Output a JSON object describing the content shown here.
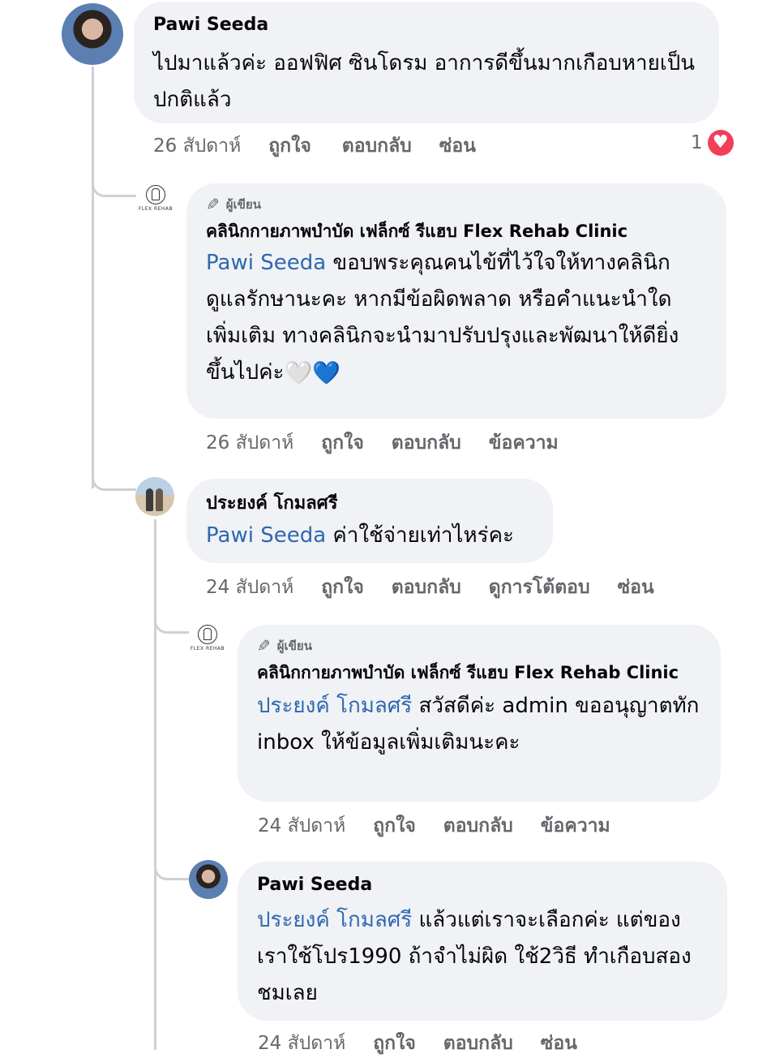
{
  "comments": [
    {
      "author": "Pawi Seeda",
      "text": "ไปมาแล้วค่ะ ออฟฟิศ ซินโดรม อาการดีขึ้นมากเกือบหายเป็นปกติแล้ว",
      "time": "26 สัปดาห์",
      "actions": [
        "ถูกใจ",
        "ตอบกลับ",
        "ซ่อน"
      ],
      "reaction_count": "1",
      "reaction_icon": "heart-icon"
    },
    {
      "badge": "ผู้เขียน",
      "author": "คลินิกกายภาพบำบัด เฟล็กซ์ รีแฮบ Flex Rehab Clinic",
      "mention": "Pawi Seeda",
      "text": " ขอบพระคุณคนไข้ที่ไว้ใจให้ทางคลินิกดูแลรักษานะคะ หากมีข้อผิดพลาด หรือคำแนะนำใดเพิ่มเติม ทางคลินิกจะนำมาปรับปรุงและพัฒนาให้ดียิ่งขึ้นไปค่ะ",
      "emoji": [
        "🤍",
        "💙"
      ],
      "time": "26 สัปดาห์",
      "actions": [
        "ถูกใจ",
        "ตอบกลับ",
        "ข้อความ"
      ],
      "logo_text": "FLEX REHAB"
    },
    {
      "author": "ประยงค์ โกมลศรี",
      "mention": "Pawi Seeda",
      "text": " ค่าใช้จ่ายเท่าไหร่คะ",
      "time": "24 สัปดาห์",
      "actions": [
        "ถูกใจ",
        "ตอบกลับ",
        "ดูการโต้ตอบ",
        "ซ่อน"
      ]
    },
    {
      "badge": "ผู้เขียน",
      "author": "คลินิกกายภาพบำบัด เฟล็กซ์ รีแฮบ Flex Rehab Clinic",
      "mention": "ประยงค์ โกมลศรี",
      "text": " สวัสดีค่ะ admin ขออนุญาตทัก inbox ให้ข้อมูลเพิ่มเติมนะคะ",
      "time": "24 สัปดาห์",
      "actions": [
        "ถูกใจ",
        "ตอบกลับ",
        "ข้อความ"
      ],
      "logo_text": "FLEX REHAB"
    },
    {
      "author": "Pawi Seeda",
      "mention": "ประยงค์ โกมลศรี",
      "text": " แล้วแต่เราจะเลือกค่ะ แต่ของเราใช้โปร1990 ถ้าจำไม่ผิด ใช้2วิธี ทำเกือบสองชมเลย",
      "time": "24 สัปดาห์",
      "actions": [
        "ถูกใจ",
        "ตอบกลับ",
        "ซ่อน"
      ]
    }
  ],
  "colors": {
    "bubble": "#f0f2f5",
    "mention": "#2e67b1",
    "meta": "#65676b",
    "heart": "#f33e58"
  }
}
